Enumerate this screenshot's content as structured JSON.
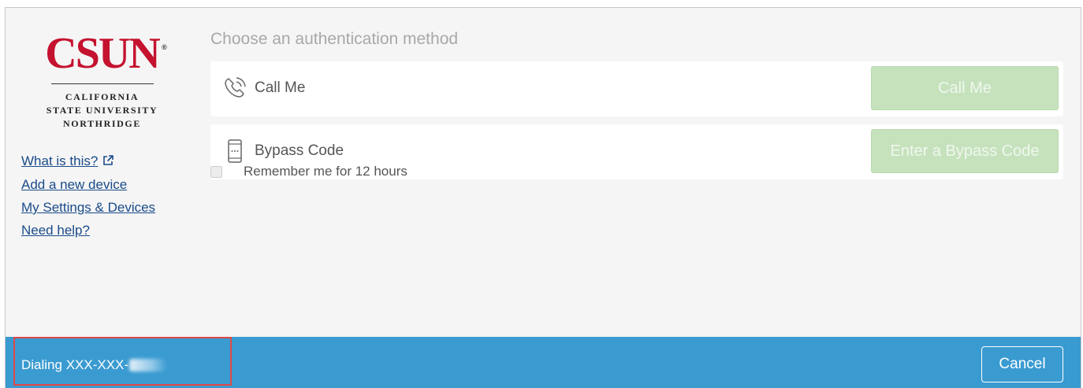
{
  "logo": {
    "wordmark": "CSUN",
    "registered": "®",
    "line1": "CALIFORNIA",
    "line2": "STATE UNIVERSITY",
    "line3": "NORTHRIDGE",
    "color": "#c4122f"
  },
  "sidebar": {
    "links": [
      {
        "label": "What is this?",
        "icon": "external-link-icon"
      },
      {
        "label": "Add a new device"
      },
      {
        "label": "My Settings & Devices"
      },
      {
        "label": "Need help?"
      }
    ]
  },
  "main": {
    "heading": "Choose an authentication method",
    "methods": [
      {
        "label": "Call Me",
        "button": "Call Me",
        "icon": "phone-icon"
      },
      {
        "label": "Bypass Code",
        "button": "Enter a Bypass Code",
        "icon": "mobile-device-icon"
      }
    ],
    "remember_label": "Remember me for 12 hours"
  },
  "status": {
    "text": "Dialing XXX-XXX-",
    "cancel_label": "Cancel",
    "bar_color": "#3a9bd1",
    "highlight_color": "#e04848"
  }
}
